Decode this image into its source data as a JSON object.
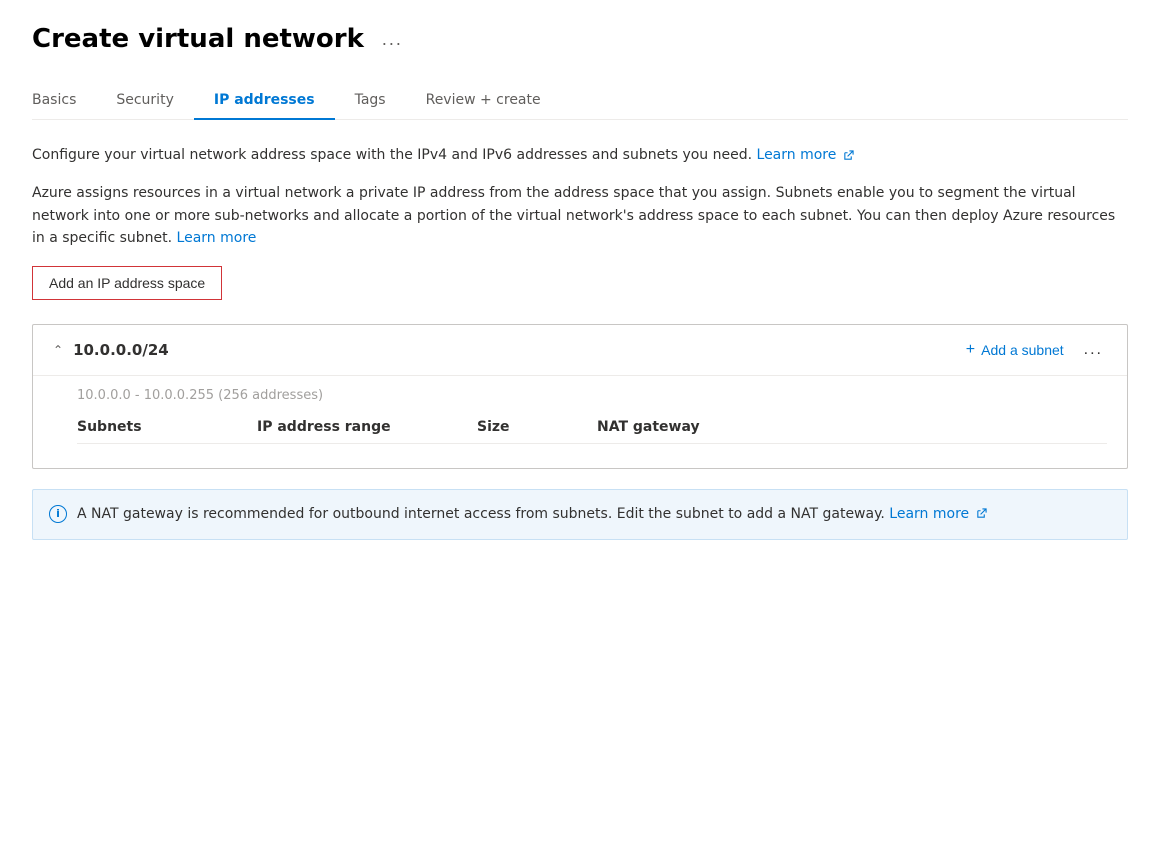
{
  "page": {
    "title": "Create virtual network",
    "ellipsis": "..."
  },
  "tabs": [
    {
      "id": "basics",
      "label": "Basics",
      "active": false
    },
    {
      "id": "security",
      "label": "Security",
      "active": false
    },
    {
      "id": "ip-addresses",
      "label": "IP addresses",
      "active": true
    },
    {
      "id": "tags",
      "label": "Tags",
      "active": false
    },
    {
      "id": "review-create",
      "label": "Review + create",
      "active": false
    }
  ],
  "description1": "Configure your virtual network address space with the IPv4 and IPv6 addresses and subnets you need.",
  "description1_link": "Learn more",
  "description2": "Azure assigns resources in a virtual network a private IP address from the address space that you assign. Subnets enable you to segment the virtual network into one or more sub-networks and allocate a portion of the virtual network's address space to each subnet. You can then deploy Azure resources in a specific subnet.",
  "description2_link": "Learn more",
  "add_ip_btn": "Add an IP address space",
  "ip_space": {
    "cidr": "10.0.0.0/24",
    "range_text": "10.0.0.0 - 10.0.0.255 (256 addresses)",
    "add_subnet_label": "Add a subnet",
    "more": "...",
    "table_headers": [
      "Subnets",
      "IP address range",
      "Size",
      "NAT gateway"
    ]
  },
  "nat_info": {
    "text": "A NAT gateway is recommended for outbound internet access from subnets. Edit the subnet to add a NAT gateway.",
    "link": "Learn more"
  }
}
